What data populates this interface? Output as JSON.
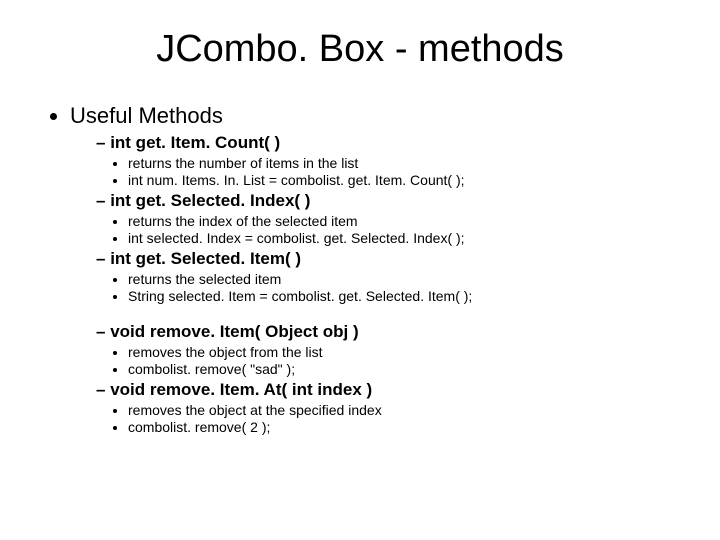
{
  "title": "JCombo. Box - methods",
  "heading": "Useful Methods",
  "methods": [
    {
      "sig": "int get. Item. Count( )",
      "d1": "returns the number of items in the list",
      "d2": "int num. Items. In. List  =  combolist. get. Item. Count( );",
      "gap": false
    },
    {
      "sig": "int get. Selected. Index( )",
      "d1": "returns the index of the selected item",
      "d2": "int selected. Index = combolist. get. Selected. Index( );",
      "gap": false
    },
    {
      "sig": "int get. Selected. Item( )",
      "d1": "returns the selected item",
      "d2": "String selected. Item = combolist. get. Selected. Item( );",
      "gap": false
    },
    {
      "sig": "void remove. Item( Object obj )",
      "d1": "removes the object from the list",
      "d2": "combolist. remove( \"sad\" );",
      "gap": true
    },
    {
      "sig": "void remove. Item. At( int index )",
      "d1": "removes the object at the specified index",
      "d2": "combolist. remove( 2 );",
      "gap": false
    }
  ]
}
